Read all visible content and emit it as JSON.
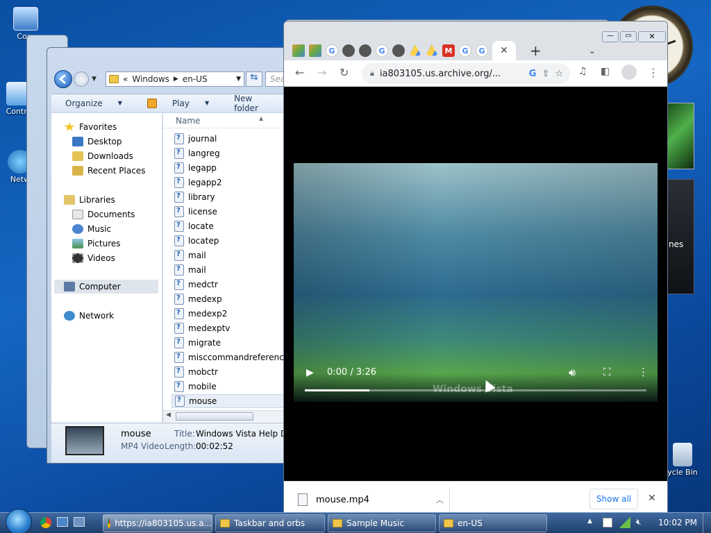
{
  "desktop": {
    "icons": [
      {
        "label": "Com",
        "icon": "computer-icon"
      },
      {
        "label": "Contro",
        "icon": "control-panel-icon"
      },
      {
        "label": "Netw",
        "icon": "network-icon"
      },
      {
        "label": "ycle Bin",
        "icon": "recycle-bin-icon"
      }
    ],
    "gadget_text": "nes"
  },
  "explorer": {
    "breadcrumb": [
      "«",
      "Windows",
      "en-US"
    ],
    "search_placeholder": "Sea",
    "toolbar": {
      "organize": "Organize",
      "play": "Play",
      "new_folder": "New folder"
    },
    "nav": {
      "favorites": "Favorites",
      "desktop": "Desktop",
      "downloads": "Downloads",
      "recent": "Recent Places",
      "libraries": "Libraries",
      "documents": "Documents",
      "music": "Music",
      "pictures": "Pictures",
      "videos": "Videos",
      "computer": "Computer",
      "network": "Network"
    },
    "column_header": "Name",
    "files": [
      "journal",
      "langreg",
      "legapp",
      "legapp2",
      "library",
      "license",
      "locate",
      "locatep",
      "mail",
      "mail",
      "medctr",
      "medexp",
      "medexp2",
      "medexptv",
      "migrate",
      "misccommandreference",
      "mobctr",
      "mobile",
      "mouse"
    ],
    "details": {
      "name": "mouse",
      "type": "MP4 Video",
      "title_label": "Title:",
      "title_value": "Windows Vista Help Der",
      "length_label": "Length:",
      "length_value": "00:02:52"
    }
  },
  "chrome": {
    "url": "ia803105.us.archive.org/...",
    "video": {
      "time": "0:00 / 3:26",
      "watermark": "Windows Vista",
      "progress": 0.19
    },
    "download": {
      "filename": "mouse.mp4",
      "show_all": "Show all"
    }
  },
  "taskbar": {
    "items": [
      "https://ia803105.us.a...",
      "Taskbar and orbs",
      "Sample Music",
      "en-US"
    ],
    "clock": "10:02 PM"
  },
  "colors": {
    "accent": "#1a73e8",
    "video_top": "#9dc2c9",
    "video_green": "#58a64d"
  }
}
